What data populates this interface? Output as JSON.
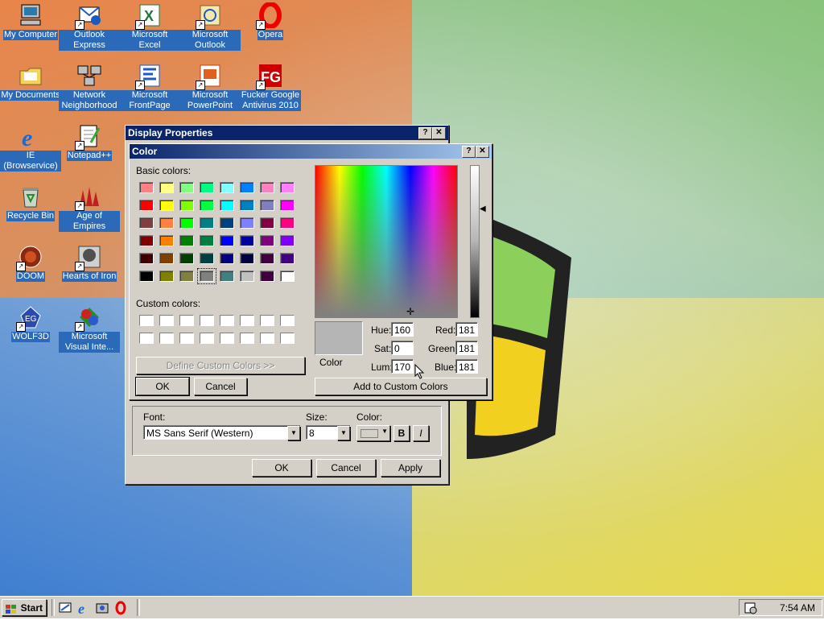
{
  "desktop": {
    "icons": [
      {
        "label": "My Computer",
        "icon": "computer-icon"
      },
      {
        "label": "Outlook Express",
        "icon": "outlook-express-icon"
      },
      {
        "label": "Microsoft Excel",
        "icon": "excel-icon"
      },
      {
        "label": "Microsoft Outlook",
        "icon": "outlook-icon"
      },
      {
        "label": "Opera",
        "icon": "opera-icon"
      },
      {
        "label": "My Documents",
        "icon": "folder-icon"
      },
      {
        "label": "Network Neighborhood",
        "icon": "network-icon"
      },
      {
        "label": "Microsoft FrontPage",
        "icon": "frontpage-icon"
      },
      {
        "label": "Microsoft PowerPoint",
        "icon": "powerpoint-icon"
      },
      {
        "label": "Fucker Google Antivirus 2010",
        "icon": "antivirus-icon"
      },
      {
        "label": "IE (Browservice)",
        "icon": "ie-icon"
      },
      {
        "label": "Notepad++",
        "icon": "notepad-icon"
      },
      {
        "label": "Recycle Bin",
        "icon": "recycle-bin-icon"
      },
      {
        "label": "Age of Empires",
        "icon": "age-of-empires-icon"
      },
      {
        "label": "DOOM",
        "icon": "doom-icon"
      },
      {
        "label": "Hearts of Iron",
        "icon": "hearts-of-iron-icon"
      },
      {
        "label": "WOLF3D",
        "icon": "wolf3d-icon"
      },
      {
        "label": "Microsoft Visual Inte...",
        "icon": "visual-interdev-icon"
      }
    ]
  },
  "display_properties": {
    "title": "Display Properties",
    "help": "?",
    "close": "✕",
    "font_label": "Font:",
    "font_value": "MS Sans Serif (Western)",
    "size_label": "Size:",
    "size_value": "8",
    "color_label": "Color:",
    "bold": "B",
    "italic": "I",
    "ok": "OK",
    "cancel": "Cancel",
    "apply": "Apply"
  },
  "color_dialog": {
    "title": "Color",
    "help": "?",
    "close": "✕",
    "basic_colors_label": "Basic colors:",
    "basic_colors": [
      "#ff8080",
      "#ffff80",
      "#80ff80",
      "#00ff80",
      "#80ffff",
      "#0080ff",
      "#ff80c0",
      "#ff80ff",
      "#ff0000",
      "#ffff00",
      "#80ff00",
      "#00ff40",
      "#00ffff",
      "#0080c0",
      "#8080c0",
      "#ff00ff",
      "#804040",
      "#ff8040",
      "#00ff00",
      "#008080",
      "#004080",
      "#8080ff",
      "#800040",
      "#ff0080",
      "#800000",
      "#ff8000",
      "#008000",
      "#008040",
      "#0000ff",
      "#0000a0",
      "#800080",
      "#8000ff",
      "#400000",
      "#804000",
      "#004000",
      "#004040",
      "#000080",
      "#000040",
      "#400040",
      "#400080",
      "#000000",
      "#808000",
      "#808040",
      "#808080",
      "#408080",
      "#c0c0c0",
      "#400040",
      "#ffffff"
    ],
    "selected_basic_index": 43,
    "custom_colors_label": "Custom colors:",
    "define_custom": "Define Custom Colors >>",
    "ok": "OK",
    "cancel": "Cancel",
    "color_solid_label": "Color",
    "hue_label": "Hue:",
    "hue": "160",
    "sat_label": "Sat:",
    "sat": "0",
    "lum_label": "Lum:",
    "lum": "170",
    "red_label": "Red:",
    "red": "181",
    "green_label": "Green:",
    "green": "181",
    "blue_label": "Blue:",
    "blue": "181",
    "add_custom": "Add to Custom Colors",
    "current_color": "#b5b5b5"
  },
  "taskbar": {
    "start": "Start",
    "clock": "7:54 AM",
    "quicklaunch": [
      "show-desktop-icon",
      "ie-icon",
      "channels-icon",
      "opera-icon"
    ]
  }
}
